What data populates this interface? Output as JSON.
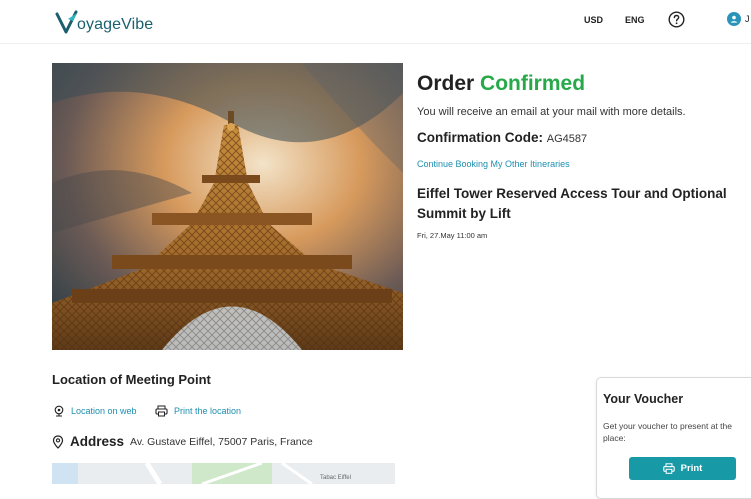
{
  "header": {
    "logo_text": "oyageVibe",
    "currency": "USD",
    "language": "ENG",
    "user_initial": "J"
  },
  "order": {
    "title_part1": "Order ",
    "title_part2": "Confirmed",
    "info": "You will receive an email at your mail with more details.",
    "confirmation_label": "Confirmation Code:",
    "confirmation_code": "AG4587",
    "continue_link": "Continue Booking My Other Itineraries",
    "tour_title": "Eiffel Tower Reserved Access Tour and Optional Summit by Lift",
    "tour_date": "Fri, 27.May 11:00 am"
  },
  "meeting": {
    "title": "Location of Meeting Point",
    "location_web": "Location on web",
    "print_location": "Print the location",
    "address_label": "Address",
    "address_value": "Av. Gustave Eiffel, 75007 Paris, France",
    "map_label_1": "Tabac Eiffel"
  },
  "voucher": {
    "title": "Your Voucher",
    "description": "Get your voucher to present at the place:",
    "print_label": "Print"
  },
  "colors": {
    "accent": "#179aa6",
    "link": "#1d8fb0",
    "confirmed": "#27a94a",
    "brand": "#1b5f6e"
  }
}
